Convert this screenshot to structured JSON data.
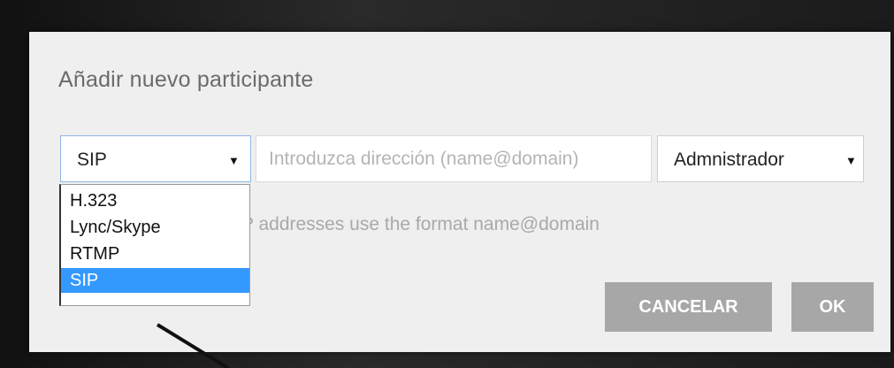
{
  "dialog": {
    "title": "Añadir nuevo participante",
    "protocol_select": {
      "selected": "SIP",
      "options": [
        "H.323",
        "Lync/Skype",
        "RTMP",
        "SIP"
      ]
    },
    "address_input": {
      "placeholder": "Introduzca dirección (name@domain)",
      "value": ""
    },
    "role_select": {
      "selected": "Admnistrador"
    },
    "hint": "P addresses use the format name@domain",
    "buttons": {
      "cancel": "CANCELAR",
      "ok": "OK"
    }
  },
  "icons": {
    "dropdown_arrow": "▼"
  },
  "colors": {
    "selected_option": "#3399ff",
    "button_bg": "#a7a7a7",
    "dialog_bg": "#efefef"
  }
}
